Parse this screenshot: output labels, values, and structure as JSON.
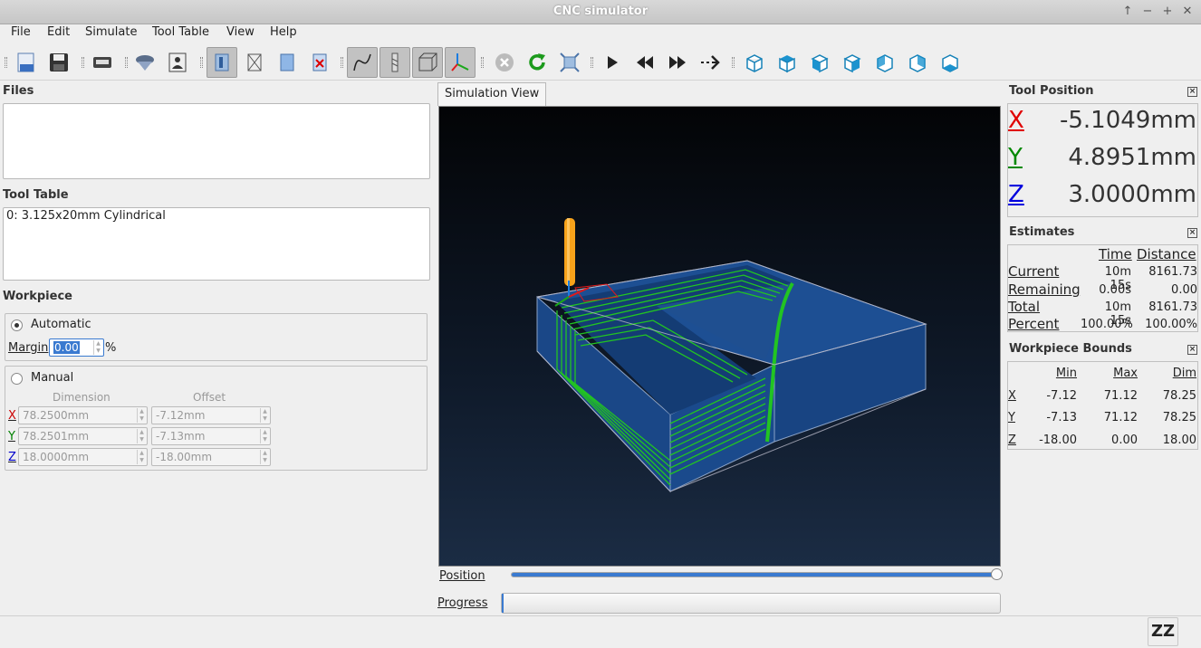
{
  "window": {
    "title": "CNC simulator",
    "buttons": [
      "↑",
      "−",
      "+",
      "✕"
    ]
  },
  "menu": [
    "File",
    "Edit",
    "Simulate",
    "Tool Table",
    "View",
    "Help"
  ],
  "toolbar": {
    "icons": [
      "open-file-icon",
      "save-icon",
      "settings-icon",
      "tool-icon",
      "tool-info-icon",
      "workpiece-icon",
      "wireframe-icon",
      "stock-icon",
      "clear-icon",
      "toolpath-icon",
      "tool-shape-icon",
      "bounding-box-icon",
      "axes-icon",
      "stop-icon",
      "reload-icon",
      "fit-icon",
      "play-icon",
      "rewind-icon",
      "fast-forward-icon",
      "step-icon",
      "view-iso-icon",
      "view-top-icon",
      "view-front-icon",
      "view-right-icon",
      "view-left-icon",
      "view-back-icon",
      "view-bottom-icon"
    ],
    "checked": [
      "workpiece-icon",
      "toolpath-icon",
      "tool-shape-icon",
      "bounding-box-icon",
      "axes-icon"
    ]
  },
  "files": {
    "heading": "Files"
  },
  "tool_table": {
    "heading": "Tool Table",
    "items": [
      "0: 3.125x20mm Cylindrical"
    ]
  },
  "workpiece": {
    "heading": "Workpiece",
    "automatic": {
      "label": "Automatic",
      "margin_label": "Margin",
      "margin_value": "0.00",
      "unit": "%"
    },
    "manual": {
      "label": "Manual",
      "dimension_header": "Dimension",
      "offset_header": "Offset",
      "rows": [
        {
          "axis": "X",
          "color": "#cc0000",
          "dimension": "78.2500mm",
          "offset": "-7.12mm"
        },
        {
          "axis": "Y",
          "color": "#008000",
          "dimension": "78.2501mm",
          "offset": "-7.13mm"
        },
        {
          "axis": "Z",
          "color": "#0000cc",
          "dimension": "18.0000mm",
          "offset": "-18.00mm"
        }
      ]
    }
  },
  "simulation": {
    "tab": "Simulation View",
    "position_label": "Position",
    "position_value": 1.0,
    "progress_label": "Progress",
    "progress_value": 0.0
  },
  "tool_position": {
    "heading": "Tool Position",
    "rows": [
      {
        "axis": "X",
        "color": "#e00000",
        "value": "-5.1049mm"
      },
      {
        "axis": "Y",
        "color": "#008800",
        "value": "4.8951mm"
      },
      {
        "axis": "Z",
        "color": "#0000dd",
        "value": "3.0000mm"
      }
    ]
  },
  "estimates": {
    "heading": "Estimates",
    "col_time": "Time",
    "col_distance": "Distance",
    "rows": [
      {
        "label": "Current",
        "time": "10m 15s",
        "distance": "8161.73"
      },
      {
        "label": "Remaining",
        "time": "0.00s",
        "distance": "0.00"
      },
      {
        "label": "Total",
        "time": "10m 15s",
        "distance": "8161.73"
      },
      {
        "label": "Percent",
        "time": "100.00%",
        "distance": "100.00%"
      }
    ]
  },
  "bounds": {
    "heading": "Workpiece Bounds",
    "col_min": "Min",
    "col_max": "Max",
    "col_dim": "Dim",
    "rows": [
      {
        "axis": "X",
        "min": "-7.12",
        "max": "71.12",
        "dim": "78.25"
      },
      {
        "axis": "Y",
        "min": "-7.13",
        "max": "71.12",
        "dim": "78.25"
      },
      {
        "axis": "Z",
        "min": "-18.00",
        "max": "0.00",
        "dim": "18.00"
      }
    ]
  },
  "status": {
    "sleep_icon": "ZZ"
  },
  "colors": {
    "accent": "#3a7ad0",
    "stock": "#1d4f93",
    "toolpath": "#22c422",
    "tool": "#f7a21a"
  }
}
